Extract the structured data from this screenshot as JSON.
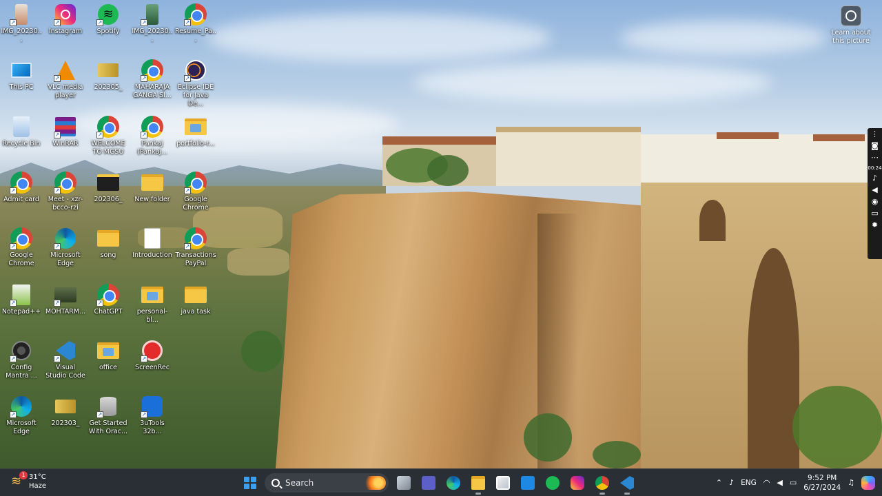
{
  "desktop": {
    "icons": [
      {
        "id": "img1",
        "label": "IMG_20230...",
        "type": "phone-img"
      },
      {
        "id": "instagram",
        "label": "Instagram",
        "type": "instagram"
      },
      {
        "id": "spotify",
        "label": "Spotify",
        "type": "spotify"
      },
      {
        "id": "img2",
        "label": "IMG_20230...",
        "type": "phone-img green"
      },
      {
        "id": "resume",
        "label": "Resume_Pa...",
        "type": "chrome"
      },
      {
        "id": "thispc",
        "label": "This PC",
        "type": "monitor"
      },
      {
        "id": "vlc",
        "label": "VLC media player",
        "type": "vlc"
      },
      {
        "id": "f202305",
        "label": "202305_",
        "type": "card"
      },
      {
        "id": "maharaja",
        "label": "MAHARAJA GANGA SI...",
        "type": "chrome"
      },
      {
        "id": "eclipse",
        "label": "Eclipse IDE for Java De...",
        "type": "eclipse"
      },
      {
        "id": "recycle",
        "label": "Recycle Bin",
        "type": "recycle"
      },
      {
        "id": "winrar",
        "label": "WinRAR",
        "type": "winrar"
      },
      {
        "id": "welcome",
        "label": "WELCOME TO MGSU",
        "type": "chrome"
      },
      {
        "id": "pankaj",
        "label": "Pankaj (Pankaj...",
        "type": "chrome"
      },
      {
        "id": "portfolio",
        "label": "portfolio-r...",
        "type": "folder pic"
      },
      {
        "id": "admit",
        "label": "Admit card",
        "type": "chrome"
      },
      {
        "id": "meet",
        "label": "Meet - xzr-bcco-rzi",
        "type": "chrome"
      },
      {
        "id": "f202306",
        "label": "202306_",
        "type": "folder dark"
      },
      {
        "id": "newfolder",
        "label": "New folder",
        "type": "folder"
      },
      {
        "id": "gchrome1",
        "label": "Google Chrome",
        "type": "chrome"
      },
      {
        "id": "gchrome2",
        "label": "Google Chrome",
        "type": "chrome"
      },
      {
        "id": "msedge1",
        "label": "Microsoft Edge",
        "type": "edge"
      },
      {
        "id": "song",
        "label": "song",
        "type": "folder"
      },
      {
        "id": "intro",
        "label": "Introduction",
        "type": "doc"
      },
      {
        "id": "transactions",
        "label": "Transactions PayPal",
        "type": "chrome"
      },
      {
        "id": "notepadpp",
        "label": "Notepad++",
        "type": "notepad"
      },
      {
        "id": "mohtarm",
        "label": "MOHTARM...",
        "type": "mohtarm"
      },
      {
        "id": "chatgpt",
        "label": "ChatGPT",
        "type": "chrome"
      },
      {
        "id": "personal",
        "label": "personal-bl...",
        "type": "folder pic"
      },
      {
        "id": "javatask",
        "label": "java task",
        "type": "folder"
      },
      {
        "id": "config",
        "label": "Config Mantra ...",
        "type": "config"
      },
      {
        "id": "vscode",
        "label": "Visual Studio Code",
        "type": "vscode"
      },
      {
        "id": "office",
        "label": "office",
        "type": "folder pic"
      },
      {
        "id": "screenrec",
        "label": "ScreenRec",
        "type": "screenrec"
      },
      {
        "id": "msedge2",
        "label": "Microsoft Edge",
        "type": "edge"
      },
      {
        "id": "f202303",
        "label": "202303_",
        "type": "card"
      },
      {
        "id": "oracle",
        "label": "Get Started With Orac...",
        "type": "oracle"
      },
      {
        "id": "tools3u",
        "label": "3uTools 32b...",
        "type": "tools3u"
      }
    ]
  },
  "learn_about": {
    "label": "Learn about this picture",
    "icon": "camera-icon"
  },
  "recorder": {
    "timer": "00:24"
  },
  "taskbar": {
    "weather": {
      "temp": "31°C",
      "condition": "Haze",
      "badge": "1"
    },
    "search": {
      "placeholder": "Search"
    },
    "apps": [
      {
        "id": "taskview",
        "icon": "taskview",
        "active": false
      },
      {
        "id": "teams",
        "icon": "teams",
        "active": false
      },
      {
        "id": "edge",
        "icon": "edge-m",
        "active": false
      },
      {
        "id": "files",
        "icon": "files",
        "active": true
      },
      {
        "id": "store",
        "icon": "store",
        "active": false
      },
      {
        "id": "mail",
        "icon": "mail",
        "active": false
      },
      {
        "id": "spotify",
        "icon": "spot",
        "active": false
      },
      {
        "id": "instagram",
        "icon": "insta",
        "active": false
      },
      {
        "id": "chrome",
        "icon": "chrome-m",
        "active": true
      },
      {
        "id": "vscode",
        "icon": "vsc",
        "active": true
      }
    ],
    "tray": {
      "language": "ENG",
      "time": "9:52 PM",
      "date": "6/27/2024"
    }
  }
}
